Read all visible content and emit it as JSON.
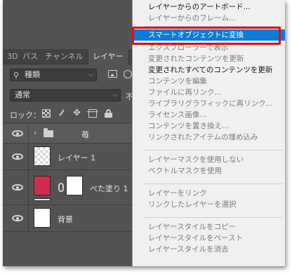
{
  "tabs": [
    {
      "label": "3D",
      "active": false
    },
    {
      "label": "パス",
      "active": false
    },
    {
      "label": "チャンネル",
      "active": false
    },
    {
      "label": "レイヤー",
      "active": true
    }
  ],
  "filter": {
    "value": "種類"
  },
  "blend": {
    "value": "通常",
    "opacity_prefix": "不"
  },
  "lock": {
    "label": "ロック："
  },
  "layers": [
    {
      "name": "苺",
      "kind": "group"
    },
    {
      "name": "レイヤー 1",
      "kind": "transparent"
    },
    {
      "name": "べた塗り 1",
      "kind": "fill",
      "fill_color": "#d12c4f"
    },
    {
      "name": "背景",
      "kind": "background"
    }
  ],
  "menu": {
    "items": [
      {
        "label": "レイヤーからのアートボード...",
        "enabled": true
      },
      {
        "label": "レイヤーからのフレーム...",
        "enabled": false
      },
      {
        "label": "スマートオブジェクトに変換",
        "enabled": true,
        "highlighted": true
      },
      {
        "label": "エクスプローラーで表示",
        "enabled": false
      },
      {
        "label": "変更されたコンテンツを更新",
        "enabled": false
      },
      {
        "label": "変更されたすべてのコンテンツを更新",
        "enabled": true
      },
      {
        "label": "コンテンツを編集",
        "enabled": false
      },
      {
        "label": "ファイルに再リンク...",
        "enabled": false
      },
      {
        "label": "ライブラリグラフィックに再リンク...",
        "enabled": false
      },
      {
        "label": "ライセンス画像...",
        "enabled": false
      },
      {
        "label": "コンテンツを置き換え...",
        "enabled": false
      },
      {
        "label": "リンクされたアイテムの埋め込み",
        "enabled": false
      },
      {
        "label": "レイヤーマスクを使用しない",
        "enabled": false
      },
      {
        "label": "ベクトルマスクを使用",
        "enabled": false
      },
      {
        "label": "レイヤーをリンク",
        "enabled": false
      },
      {
        "label": "リンクしたレイヤーを選択",
        "enabled": false
      },
      {
        "label": "レイヤースタイルをコピー",
        "enabled": false
      },
      {
        "label": "レイヤースタイルをペースト",
        "enabled": false
      },
      {
        "label": "レイヤースタイルを消去",
        "enabled": false
      }
    ]
  },
  "colors": {
    "panel": "#535353",
    "menu_bg": "#f0f0f0",
    "highlight": "#0c7bd6",
    "annotation_box": "#e01010"
  }
}
